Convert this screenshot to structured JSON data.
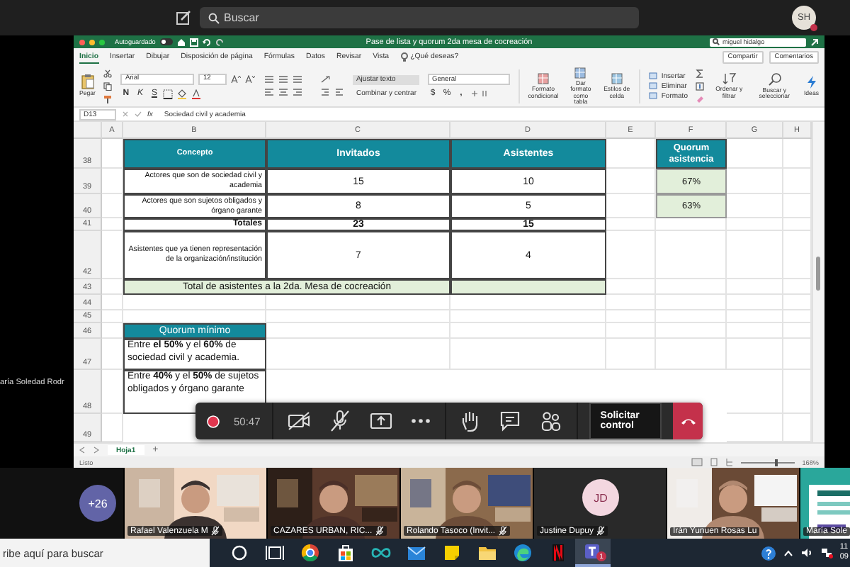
{
  "meeting_bar": {
    "search": {
      "placeholder": "Buscar"
    },
    "avatar": {
      "initials": "SH"
    }
  },
  "side_caption": "aría Soledad Rodr",
  "excel": {
    "autosave": {
      "label": "Autoguardado",
      "on": false
    },
    "title": "Pase de lista y quorum 2da mesa de cocreación",
    "search": {
      "value": "miguel hidalgo"
    },
    "tabs": [
      {
        "label": "Inicio",
        "selected": true
      },
      {
        "label": "Insertar",
        "selected": false
      },
      {
        "label": "Dibujar",
        "selected": false
      },
      {
        "label": "Disposición de página",
        "selected": false
      },
      {
        "label": "Fórmulas",
        "selected": false
      },
      {
        "label": "Datos",
        "selected": false
      },
      {
        "label": "Revisar",
        "selected": false
      },
      {
        "label": "Vista",
        "selected": false
      }
    ],
    "tell_me": "¿Qué deseas?",
    "share": "Compartir",
    "comments": "Comentarios",
    "ribbon": {
      "paste": "Pegar",
      "font": "Arial",
      "size": "12",
      "bold": "N",
      "italic": "K",
      "underline": "S",
      "wrap": "Ajustar texto",
      "merge": "Combinar y centrar",
      "number_format": "General",
      "currency": "$",
      "percent": "%",
      "thousands": ",",
      "conditional": "Formato condicional",
      "as_table": "Dar formato como tabla",
      "styles": "Estilos de celda",
      "insert": "Insertar",
      "delete": "Eliminar",
      "format": "Formato",
      "sort": "Ordenar y filtrar",
      "find": "Buscar y seleccionar",
      "ideas": "Ideas"
    },
    "name_box": "D13",
    "function_label": "fx",
    "formula": "Sociedad civil y academia",
    "sheet": {
      "columns": [
        "A",
        "B",
        "C",
        "D",
        "E",
        "F",
        "G",
        "H"
      ],
      "rows": [
        "38",
        "39",
        "40",
        "41",
        "42",
        "43",
        "44",
        "45",
        "46",
        "47",
        "48",
        "49"
      ],
      "main_table": {
        "headers": [
          "Concepto",
          "Invitados",
          "Asistentes"
        ],
        "rows": [
          [
            "Actores que son de sociedad civil y academia",
            "15",
            "10"
          ],
          [
            "Actores que son sujetos obligados y órgano garante",
            "8",
            "5"
          ],
          [
            "Totales",
            "23",
            "15"
          ],
          [
            "Asistentes que  ya tienen representación de  la organización/institución",
            "7",
            "4"
          ]
        ],
        "total_note": "Total de asistentes a la 2da. Mesa de cocreación"
      },
      "quorum": {
        "header": "Quorum asistencia",
        "values": [
          "67%",
          "63%"
        ]
      },
      "minimum": {
        "header": "Quorum mínimo",
        "rows": [
          "Entre **el 50%** y el **60%** de sociedad civil y academia.",
          "Entre **40%** y el **50%** de sujetos obligados y órgano garante"
        ]
      }
    },
    "sheet_tabs": [
      {
        "label": "Hoja1",
        "selected": true
      }
    ],
    "add_sheet": "+",
    "status": "Listo",
    "zoom": "168%",
    "zoom_slider": {
      "level": 0.62
    }
  },
  "call_controls": {
    "timer": "50:47",
    "camera_on": false,
    "mic_on": false,
    "request_control": "Solicitar control"
  },
  "participants": {
    "overflow": "+26",
    "tiles": [
      {
        "kind": "video",
        "name": "Rafael Valenzuela M",
        "muted": true
      },
      {
        "kind": "video",
        "name": "CAZARES URBAN, RIC...",
        "muted": true
      },
      {
        "kind": "video",
        "name": "Rolando Tasoco (Invit...",
        "muted": true
      },
      {
        "kind": "avatar",
        "initials": "JD",
        "name": "Justine Dupuy",
        "muted": true
      },
      {
        "kind": "video",
        "name": "Irán Yunuen Rosas Lu",
        "muted": false
      },
      {
        "kind": "slide",
        "name": "María Sole",
        "muted": false
      }
    ]
  },
  "taskbar": {
    "search": {
      "placeholder": "ribe aquí para buscar"
    },
    "apps": [
      {
        "kind": "cortana",
        "selected": false
      },
      {
        "kind": "taskview",
        "selected": false
      },
      {
        "kind": "chrome",
        "selected": false
      },
      {
        "kind": "store",
        "selected": false
      },
      {
        "kind": "infinity",
        "selected": false
      },
      {
        "kind": "mail",
        "selected": false
      },
      {
        "kind": "notes",
        "selected": false
      },
      {
        "kind": "folder",
        "selected": false
      },
      {
        "kind": "edge",
        "selected": false
      },
      {
        "kind": "netflix",
        "selected": false
      },
      {
        "kind": "teams",
        "selected": true,
        "badge": "1"
      }
    ],
    "clock": [
      "11",
      "09"
    ]
  }
}
